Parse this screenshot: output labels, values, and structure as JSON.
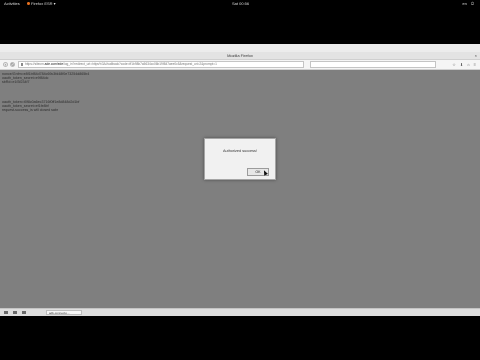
{
  "topbar": {
    "activities": "Activities",
    "app": "Firefox ESR",
    "clock": "Sat 00:56",
    "tray": [
      "en",
      "⏻"
    ]
  },
  "window": {
    "title": "Mozilla Firefox",
    "close": "×"
  },
  "navbar": {
    "url_prefix": "https://sitecm.",
    "url_domain": "ade.com/ede",
    "url_rest": "/log_in?redirect_uri=https%3A//callback?code=ff1b98b7a5634cc06b19f847aee0c5&request_uri=2&prompt=1",
    "icons": [
      "☆",
      "⬇",
      "⌂",
      "≡"
    ]
  },
  "content": {
    "lines_a": [
      "nonce/Gnfm=e8f1bf84d784c69c3fd48f0e73254d865b4",
      "oauth_token_secret=e9f84dc",
      "sbRd=e1f3f234f7"
    ],
    "lines_b": [
      "oauth_token=t0f8c0a6ec3716f0ff1e8d848d2d1bf",
      "oauth_token_secret=ef1fe8bf",
      "request-success_is will closed sabr"
    ]
  },
  "dialog": {
    "message": "Authorized success!",
    "ok_label": "OK"
  },
  "statusbar": {
    "text": "adk-connecto..."
  }
}
